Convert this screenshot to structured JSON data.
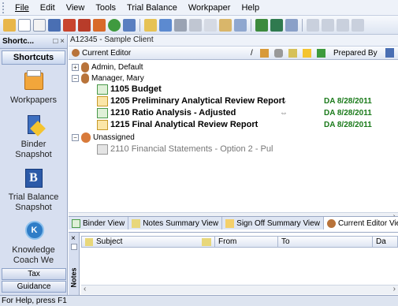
{
  "menu": [
    "File",
    "Edit",
    "View",
    "Tools",
    "Trial Balance",
    "Workpaper",
    "Help"
  ],
  "left_pane": {
    "header": "Shortc...",
    "header_controls": "□ ×",
    "title": "Shortcuts",
    "items": [
      {
        "label": "Workpapers",
        "icon": "workpapers-icon"
      },
      {
        "label": "Binder Snapshot",
        "icon": "binder-snapshot-icon"
      },
      {
        "label": "Trial Balance Snapshot",
        "icon": "trial-balance-icon"
      },
      {
        "label": "Knowledge Coach We",
        "icon": "knowledge-coach-icon"
      }
    ],
    "buttons": [
      "Tax",
      "Guidance"
    ]
  },
  "client": "A12345 - Sample Client",
  "column_header": {
    "label": "Current Editor",
    "slash": "/",
    "prepared_by": "Prepared By"
  },
  "tree": {
    "rows": [
      {
        "label": "Admin, Default"
      },
      {
        "label": "Manager, Mary"
      },
      {
        "label": "1105 Budget"
      },
      {
        "label": "1205 Preliminary Analytical Review Report",
        "sign": "DA 8/28/2011"
      },
      {
        "label": "1210 Ratio Analysis - Adjusted",
        "sign": "DA 8/28/2011"
      },
      {
        "label": "1215 Final Analytical Review Report",
        "sign": "DA 8/28/2011"
      },
      {
        "label": "Unassigned"
      },
      {
        "label": "2110 Financial Statements - Option 2 - Pul"
      }
    ]
  },
  "tabs": [
    "Binder View",
    "Notes Summary View",
    "Sign Off Summary View",
    "Current Editor View"
  ],
  "notes": {
    "side_label": "Notes",
    "columns": [
      "Subject",
      "From",
      "To",
      "Da"
    ]
  },
  "status": "For Help, press F1",
  "colors": {
    "accent": "#d7dff0",
    "sign_green": "#1a7a1a"
  }
}
